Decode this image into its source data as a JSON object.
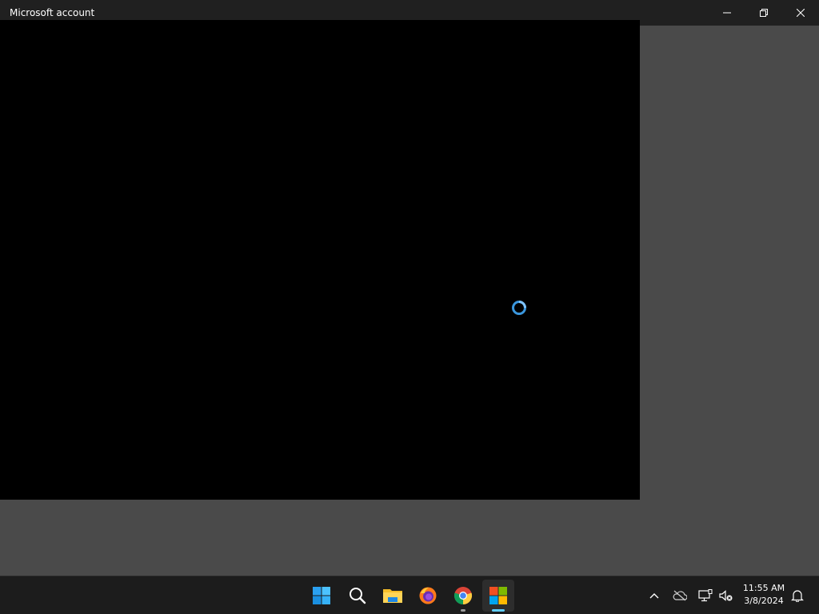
{
  "window": {
    "title": "Microsoft account",
    "controls": {
      "minimize_icon": "minimize-icon",
      "restore_icon": "restore-icon",
      "close_icon": "close-icon"
    }
  },
  "content": {
    "state": "loading",
    "spinner_icon": "loading-spinner-icon",
    "spinner_color": "#3a96dd",
    "background_color": "#000000"
  },
  "desktop": {
    "background_color": "#4a4a4a"
  },
  "taskbar": {
    "pinned_apps": [
      {
        "name": "Start",
        "icon": "windows-start-icon"
      },
      {
        "name": "Search",
        "icon": "search-icon"
      },
      {
        "name": "File Explorer",
        "icon": "folder-icon"
      },
      {
        "name": "Firefox",
        "icon": "firefox-icon"
      },
      {
        "name": "Chrome",
        "icon": "chrome-icon",
        "running": true
      },
      {
        "name": "Microsoft Store",
        "icon": "microsoft-logo-icon",
        "active": true
      }
    ],
    "tray": {
      "icons": [
        "chevron-up-icon",
        "onedrive-offline-icon",
        "network-icon",
        "volume-muted-icon",
        "notification-bell-icon"
      ],
      "time": "11:55 AM",
      "date": "3/8/2024"
    },
    "accent_color": "#60cdff"
  }
}
